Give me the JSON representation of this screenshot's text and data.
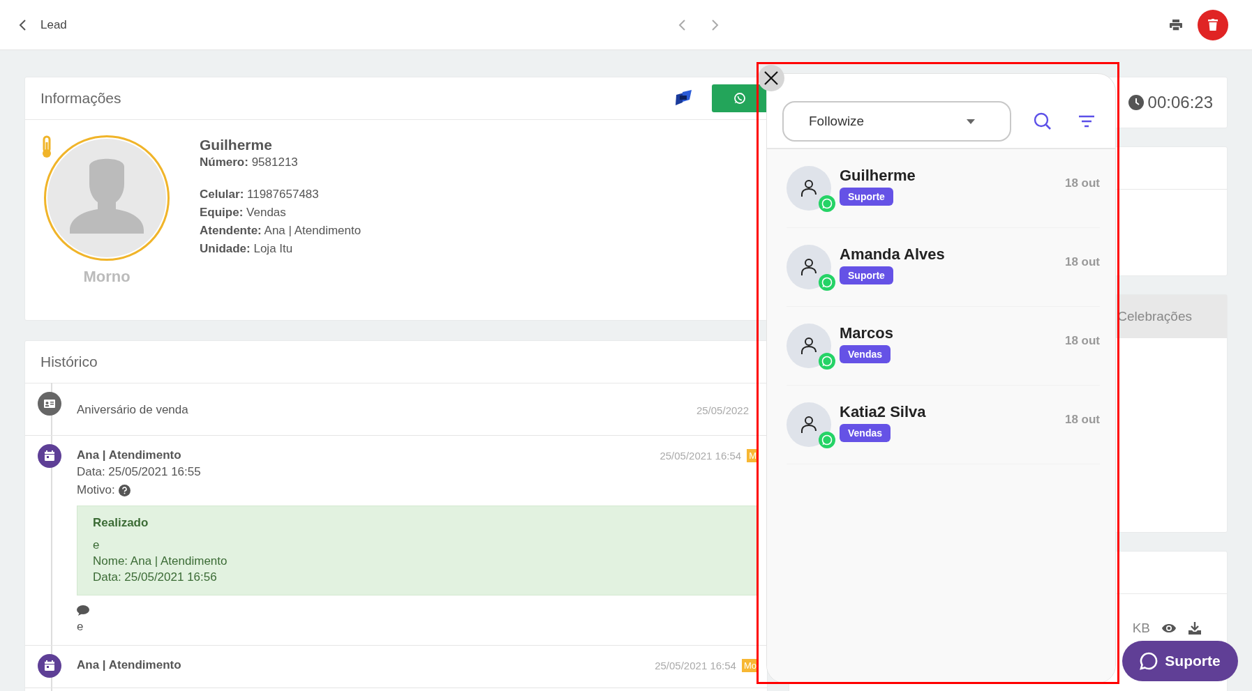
{
  "top_bar": {
    "title": "Lead"
  },
  "info_card": {
    "title": "Informações",
    "lead": {
      "name": "Guilherme",
      "temperature": "Morno",
      "id_fields": [
        {
          "label": "Número:",
          "value": "9581213"
        }
      ],
      "contact_fields": [
        {
          "label": "Celular:",
          "value": "11987657483"
        },
        {
          "label": "Equipe:",
          "value": "Vendas"
        },
        {
          "label": "Atendente:",
          "value": "Ana | Atendimento"
        },
        {
          "label": "Unidade:",
          "value": "Loja Itu"
        }
      ]
    }
  },
  "history": {
    "title": "Histórico",
    "entries": [
      {
        "kind": "event",
        "text": "Aniversário de venda",
        "date": "25/05/2022"
      },
      {
        "kind": "task",
        "author": "Ana | Atendimento",
        "date": "25/05/2021 16:54",
        "badge": "M",
        "lines": [
          "Data: 25/05/2021 16:55"
        ],
        "reason": "Motivo:",
        "result": {
          "title": "Realizado",
          "lines": [
            "e",
            "Nome: Ana | Atendimento",
            "Data: 25/05/2021 16:56"
          ]
        },
        "comment": "e"
      },
      {
        "kind": "task",
        "author": "Ana | Atendimento",
        "date": "25/05/2021 16:54",
        "badge": "Mo"
      }
    ]
  },
  "side": {
    "timer": "00:06:23",
    "tab": "Celebrações",
    "file_size": "KB"
  },
  "chat_panel": {
    "channel": "Followize",
    "contacts": [
      {
        "name": "Guilherme",
        "tag": "Suporte",
        "date": "18 out"
      },
      {
        "name": "Amanda Alves",
        "tag": "Suporte",
        "date": "18 out"
      },
      {
        "name": "Marcos",
        "tag": "Vendas",
        "date": "18 out"
      },
      {
        "name": "Katia2 Silva",
        "tag": "Vendas",
        "date": "18 out"
      }
    ]
  },
  "support_button": {
    "label": "Suporte"
  }
}
